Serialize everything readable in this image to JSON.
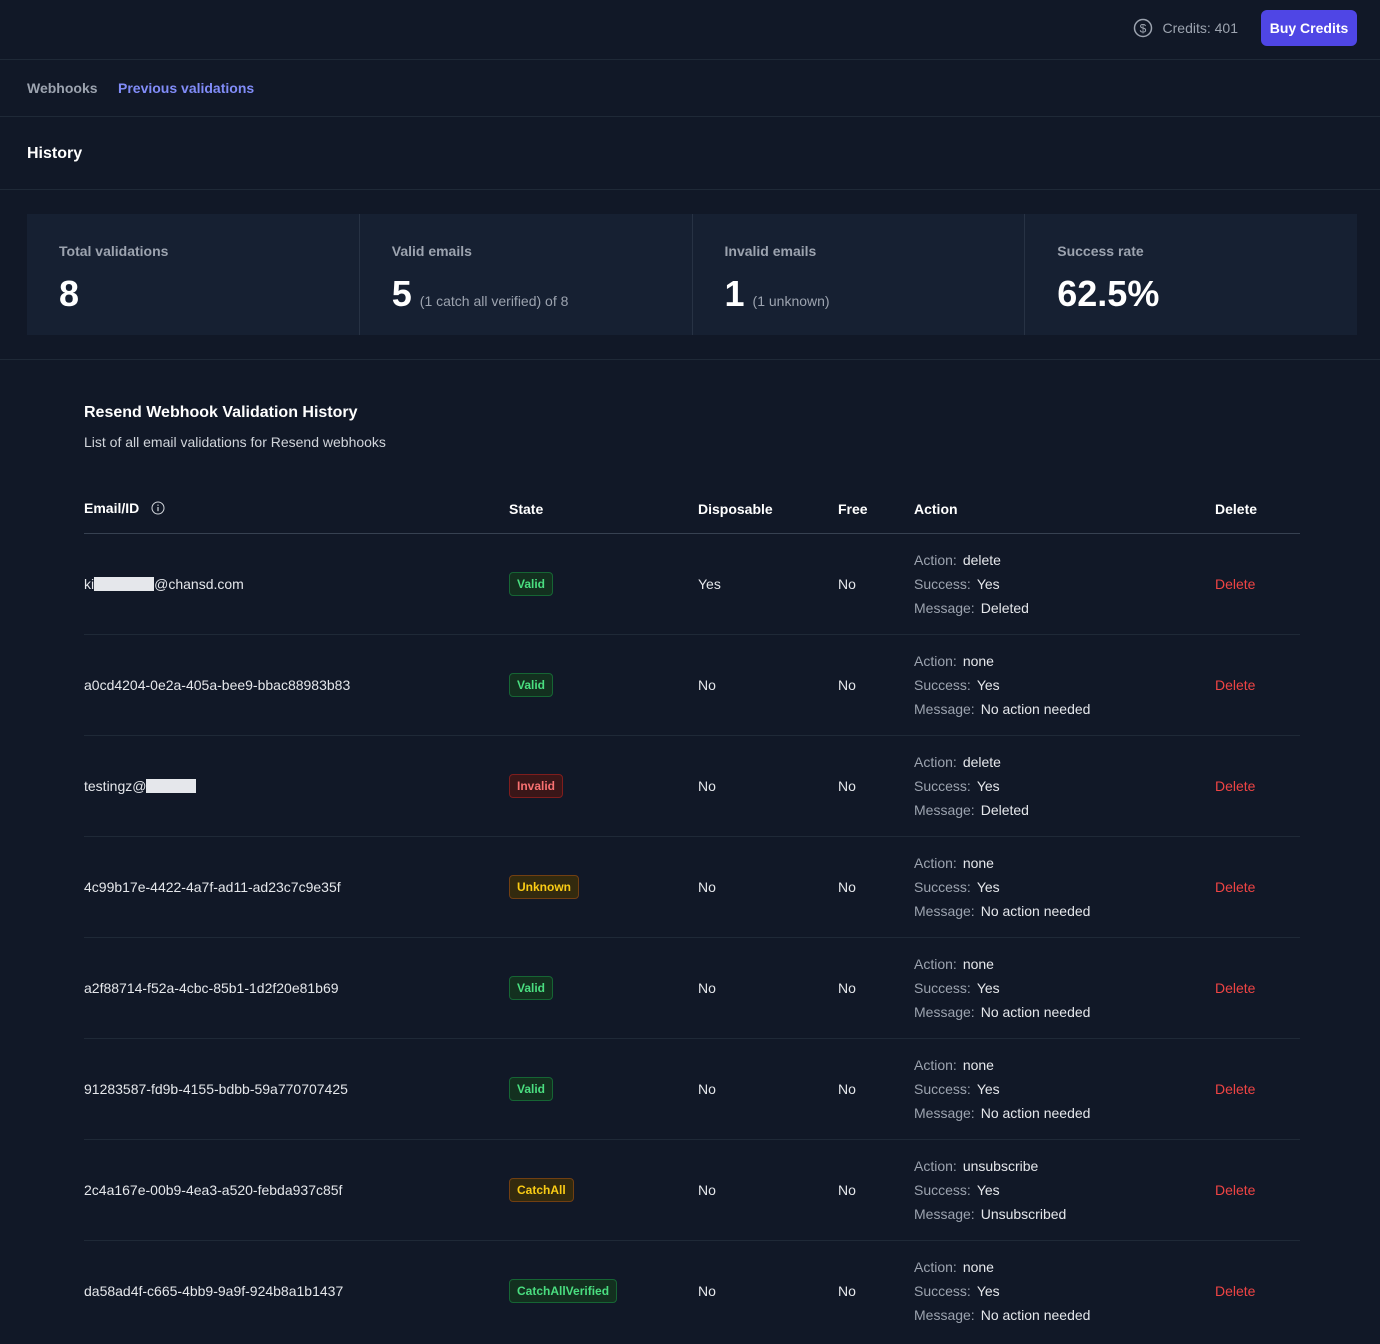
{
  "topbar": {
    "credits_label": "Credits: 401",
    "credits_icon": "dollar-circle-icon",
    "buy_label": "Buy Credits",
    "buy_color": "#4f46e5"
  },
  "nav": {
    "tabs": [
      {
        "label": "Webhooks",
        "active": false
      },
      {
        "label": "Previous validations",
        "active": true
      }
    ]
  },
  "page": {
    "title": "History"
  },
  "stats": [
    {
      "label": "Total validations",
      "value": "8",
      "detail": ""
    },
    {
      "label": "Valid emails",
      "value": "5",
      "detail": "(1 catch all verified) of 8"
    },
    {
      "label": "Invalid emails",
      "value": "1",
      "detail": "(1 unknown)"
    },
    {
      "label": "Success rate",
      "value": "62.5%",
      "detail": ""
    }
  ],
  "section": {
    "title": "Resend Webhook Validation History",
    "subtitle": "List of all email validations for Resend webhooks"
  },
  "table": {
    "headers": {
      "email": "Email/ID",
      "state": "State",
      "disposable": "Disposable",
      "free": "Free",
      "action": "Action",
      "delete": "Delete"
    },
    "action_keys": {
      "action": "Action:",
      "success": "Success:",
      "message": "Message:"
    },
    "rows": [
      {
        "email_prefix": "ki",
        "email_suffix": "@chansd.com",
        "redact_width": 60,
        "state": "Valid",
        "state_class": "valid",
        "disposable": "Yes",
        "free": "No",
        "action": "delete",
        "success": "Yes",
        "message": "Deleted",
        "delete_label": "Delete"
      },
      {
        "email_prefix": "a0cd4204-0e2a-405a-bee9-bbac88983b83",
        "email_suffix": "",
        "redact_width": 0,
        "state": "Valid",
        "state_class": "valid",
        "disposable": "No",
        "free": "No",
        "action": "none",
        "success": "Yes",
        "message": "No action needed",
        "delete_label": "Delete"
      },
      {
        "email_prefix": "testingz@",
        "email_suffix": "",
        "redact_width": 50,
        "state": "Invalid",
        "state_class": "invalid",
        "disposable": "No",
        "free": "No",
        "action": "delete",
        "success": "Yes",
        "message": "Deleted",
        "delete_label": "Delete"
      },
      {
        "email_prefix": "4c99b17e-4422-4a7f-ad11-ad23c7c9e35f",
        "email_suffix": "",
        "redact_width": 0,
        "state": "Unknown",
        "state_class": "unknown",
        "disposable": "No",
        "free": "No",
        "action": "none",
        "success": "Yes",
        "message": "No action needed",
        "delete_label": "Delete"
      },
      {
        "email_prefix": "a2f88714-f52a-4cbc-85b1-1d2f20e81b69",
        "email_suffix": "",
        "redact_width": 0,
        "state": "Valid",
        "state_class": "valid",
        "disposable": "No",
        "free": "No",
        "action": "none",
        "success": "Yes",
        "message": "No action needed",
        "delete_label": "Delete"
      },
      {
        "email_prefix": "91283587-fd9b-4155-bdbb-59a770707425",
        "email_suffix": "",
        "redact_width": 0,
        "state": "Valid",
        "state_class": "valid",
        "disposable": "No",
        "free": "No",
        "action": "none",
        "success": "Yes",
        "message": "No action needed",
        "delete_label": "Delete"
      },
      {
        "email_prefix": "2c4a167e-00b9-4ea3-a520-febda937c85f",
        "email_suffix": "",
        "redact_width": 0,
        "state": "CatchAll",
        "state_class": "catchall",
        "disposable": "No",
        "free": "No",
        "action": "unsubscribe",
        "success": "Yes",
        "message": "Unsubscribed",
        "delete_label": "Delete"
      },
      {
        "email_prefix": "da58ad4f-c665-4bb9-9a9f-924b8a1b1437",
        "email_suffix": "",
        "redact_width": 0,
        "state": "CatchAllVerified",
        "state_class": "catchallverified",
        "disposable": "No",
        "free": "No",
        "action": "none",
        "success": "Yes",
        "message": "No action needed",
        "delete_label": "Delete"
      }
    ]
  }
}
